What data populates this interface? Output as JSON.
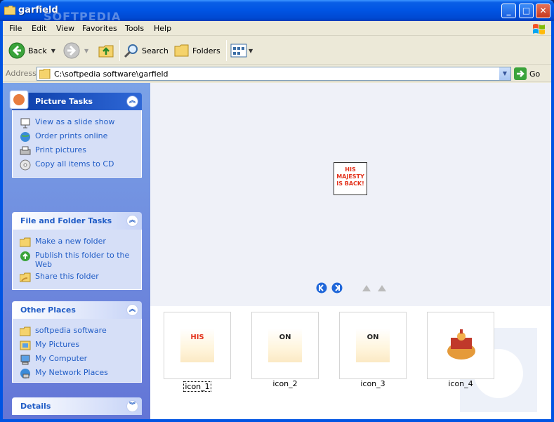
{
  "window": {
    "title": "garfield",
    "watermark": "SOFTPEDIA"
  },
  "menu": [
    "File",
    "Edit",
    "View",
    "Favorites",
    "Tools",
    "Help"
  ],
  "toolbar": {
    "back": "Back",
    "search": "Search",
    "folders": "Folders"
  },
  "address": {
    "label": "Address",
    "path": "C:\\softpedia software\\garfield",
    "go": "Go"
  },
  "panels": {
    "picture_tasks": {
      "title": "Picture Tasks",
      "items": [
        "View as a slide show",
        "Order prints online",
        "Print pictures",
        "Copy all items to CD"
      ]
    },
    "file_folder_tasks": {
      "title": "File and Folder Tasks",
      "items": [
        "Make a new folder",
        "Publish this folder to the Web",
        "Share this folder"
      ]
    },
    "other_places": {
      "title": "Other Places",
      "items": [
        "softpedia software",
        "My Pictures",
        "My Computer",
        "My Network Places"
      ]
    },
    "details": {
      "title": "Details"
    }
  },
  "preview": {
    "text": "HIS MAJESTY IS BACK!"
  },
  "thumbnails": [
    {
      "name": "icon_1",
      "text": "HIS"
    },
    {
      "name": "icon_2",
      "text": "ON"
    },
    {
      "name": "icon_3",
      "text": "ON"
    },
    {
      "name": "icon_4",
      "text": ""
    }
  ],
  "colors": {
    "link": "#215dc6",
    "titlebar": "#0054e3",
    "sidebar": "#6f8fe0"
  }
}
